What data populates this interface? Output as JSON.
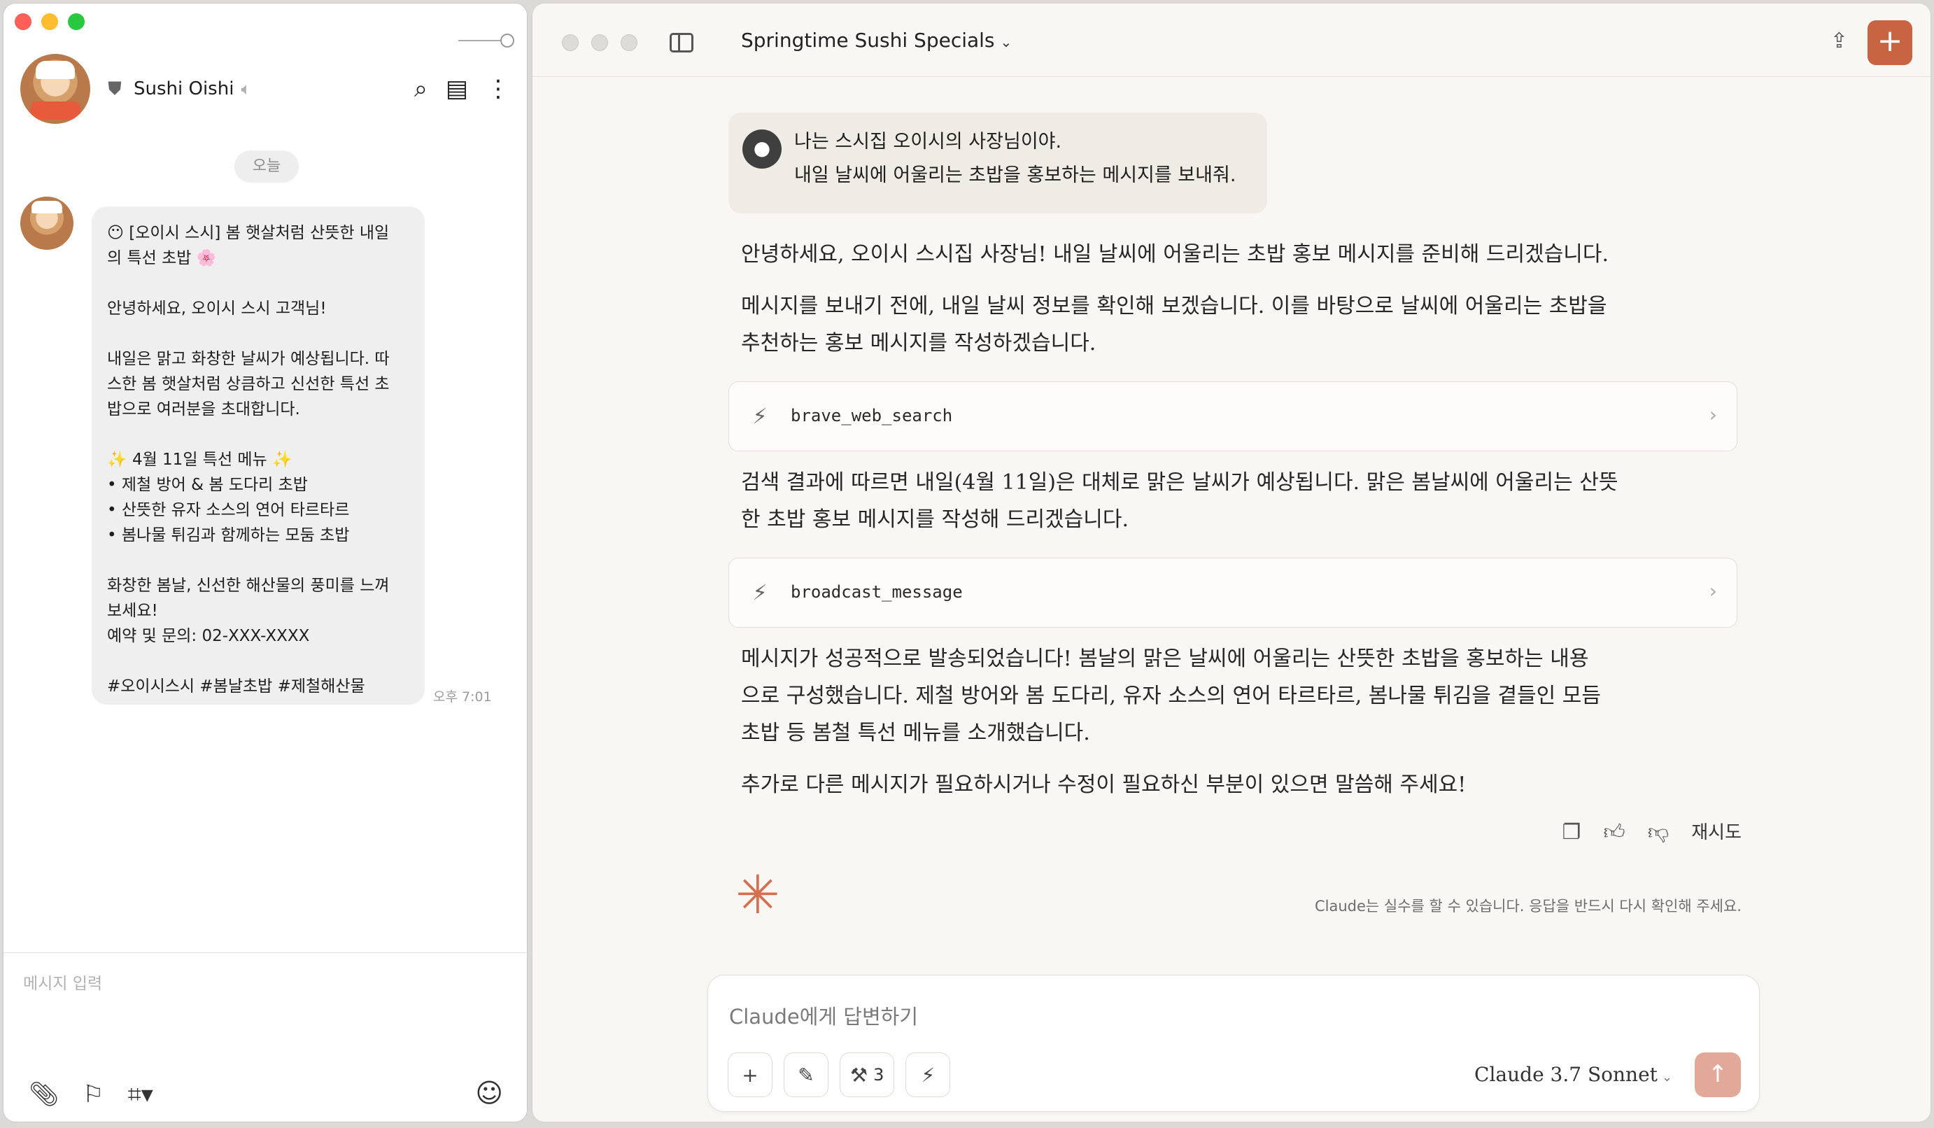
{
  "kakao": {
    "chat_name": "Sushi Oishi",
    "date_label": "오늘",
    "message_lines": [
      "😶 [오이시 스시] 봄 햇살처럼 산뜻한 내일",
      "의 특선 초밥 🌸",
      "",
      "안녕하세요, 오이시 스시 고객님!",
      "",
      "내일은 맑고 화창한 날씨가 예상됩니다. 따",
      "스한 봄 햇살처럼 상큼하고 신선한 특선 초",
      "밥으로 여러분을 초대합니다.",
      "",
      "✨ 4월 11일 특선 메뉴 ✨",
      "• 제철 방어 & 봄 도다리 초밥",
      "• 산뜻한 유자 소스의 연어 타르타르",
      "• 봄나물 튀김과 함께하는 모둠 초밥",
      "",
      "화창한 봄날, 신선한 해산물의 풍미를 느껴",
      "보세요!",
      "예약 및 문의: 02-XXX-XXXX",
      "",
      "#오이시스시 #봄날초밥 #제철해산물"
    ],
    "message_time": "오후 7:01",
    "input_placeholder": "메시지 입력"
  },
  "claude": {
    "conversation_title": "Springtime Sushi Specials",
    "user_message_lines": [
      "나는 스시집 오이시의 사장님이야.",
      "내일 날씨에 어울리는 초밥을 홍보하는 메시지를 보내줘."
    ],
    "para1": "안녕하세요, 오이시 스시집 사장님! 내일 날씨에 어울리는 초밥 홍보 메시지를 준비해 드리겠습니다.",
    "para2_lines": [
      "메시지를 보내기 전에, 내일 날씨 정보를 확인해 보겠습니다. 이를 바탕으로 날씨에 어울리는 초밥을",
      "추천하는 홍보 메시지를 작성하겠습니다."
    ],
    "tool1": "brave_web_search",
    "para3_lines": [
      "검색 결과에 따르면 내일(4월 11일)은 대체로 맑은 날씨가 예상됩니다. 맑은 봄날씨에 어울리는 산뜻",
      "한 초밥 홍보 메시지를 작성해 드리겠습니다."
    ],
    "tool2": "broadcast_message",
    "para4_lines": [
      "메시지가 성공적으로 발송되었습니다! 봄날의 맑은 날씨에 어울리는 산뜻한 초밥을 홍보하는 내용",
      "으로 구성했습니다. 제철 방어와 봄 도다리, 유자 소스의 연어 타르타르, 봄나물 튀김을 곁들인 모듬",
      "초밥 등 봄철 특선 메뉴를 소개했습니다."
    ],
    "para5": "추가로 다른 메시지가 필요하시거나 수정이 필요하신 부분이 있으면 말씀해 주세요!",
    "retry_label": "재시도",
    "disclaimer": "Claude는 실수를 할 수 있습니다. 응답을 반드시 다시 확인해 주세요.",
    "composer_placeholder": "Claude에게 답변하기",
    "tools_count": "3",
    "model_name": "Claude 3.7 Sonnet",
    "accent_color": "#c96442"
  }
}
